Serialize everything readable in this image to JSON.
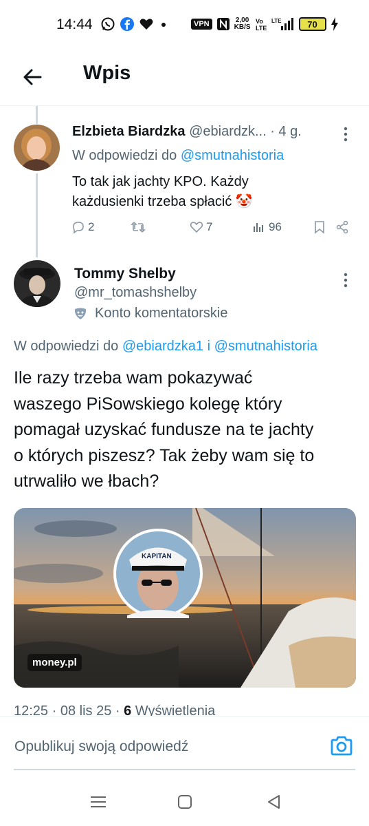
{
  "status_bar": {
    "time": "14:44",
    "vpn": "VPN",
    "speed_value": "2,00",
    "speed_unit": "KB/S",
    "battery": "70",
    "network": "LTE"
  },
  "header": {
    "title": "Wpis"
  },
  "tweet1": {
    "name": "Elzbieta Biardzka",
    "handle": "@ebiardzk...",
    "time": "· 4 g.",
    "reply_prefix": "W odpowiedzi do",
    "reply_mention": "@smutnahistoria",
    "text_line1": "To tak jak jachty KPO. Każdy",
    "text_line2": "każdusienki trzeba spłacić 🤡",
    "replies": "2",
    "likes": "7",
    "views": "96"
  },
  "tweet2": {
    "name": "Tommy Shelby",
    "handle": "@mr_tomashshelby",
    "badge": "Konto komentatorskie",
    "reply_prefix": "W odpowiedzi do",
    "reply_mention1": "@ebiardzka1",
    "reply_and": "i",
    "reply_mention2": "@smutnahistoria",
    "text_lines": [
      "Ile razy trzeba wam pokazywać",
      "waszego PiSowskiego kolegę który",
      "pomagał uzyskać fundusze na te jachty",
      "o których piszesz? Tak żeby wam się to",
      "utrwaliło we łbach?"
    ],
    "media_source": "money.pl",
    "media_cap_text": "KAPITAN",
    "timestamp": "12:25 · 08 lis 25 ·",
    "views_count": "6",
    "views_label": "Wyświetlenia"
  },
  "composer": {
    "placeholder": "Opublikuj swoją odpowiedź"
  },
  "colors": {
    "accent": "#1d9bf0",
    "secondary_text": "#536471",
    "primary_text": "#0f1419"
  }
}
